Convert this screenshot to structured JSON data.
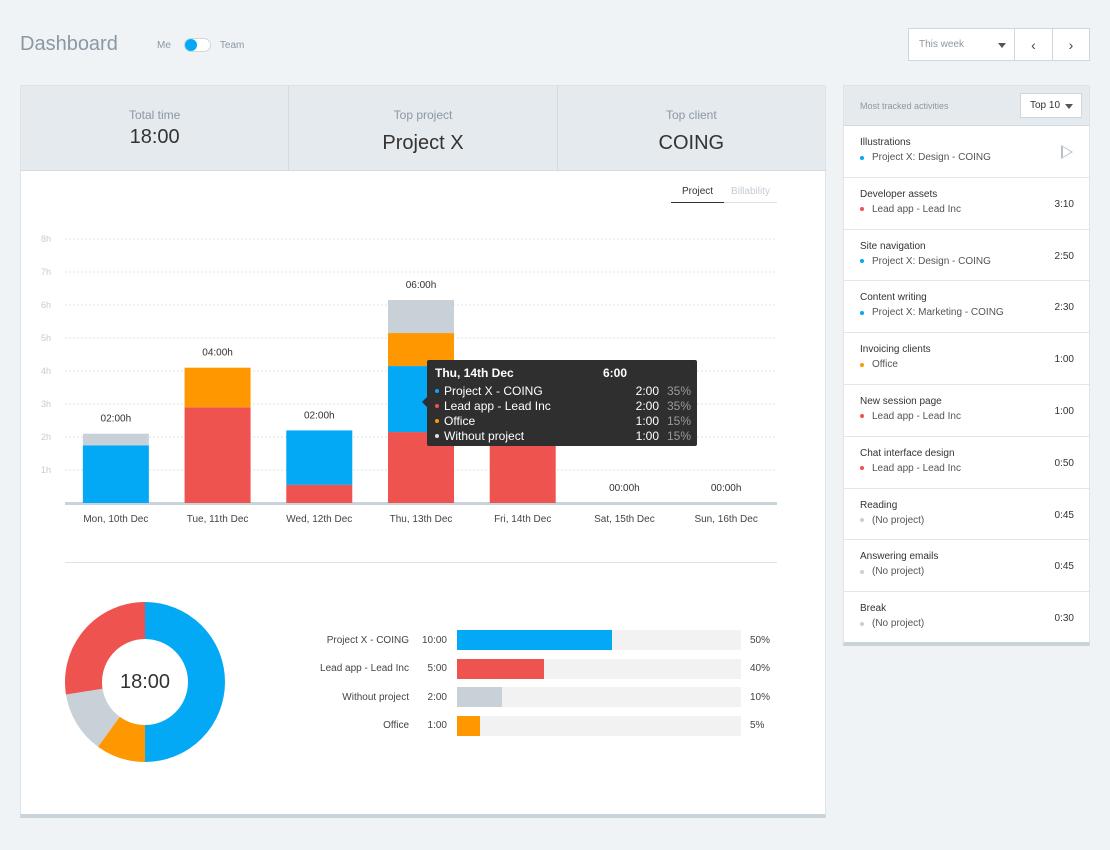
{
  "header": {
    "title": "Dashboard",
    "toggle_left": "Me",
    "toggle_right": "Team",
    "range_label": "This week",
    "prev_glyph": "‹",
    "next_glyph": "›"
  },
  "summary": [
    {
      "label": "Total time",
      "value": "18:00"
    },
    {
      "label": "Top project",
      "value": "Project X"
    },
    {
      "label": "Top client",
      "value": "COING"
    }
  ],
  "chart_tabs": [
    "Project",
    "Billability"
  ],
  "colors": {
    "project_x": "#03a9f4",
    "lead_app": "#ef5350",
    "office": "#ff9800",
    "no_project": "#c8d1d8"
  },
  "chart_data": {
    "type": "bar",
    "stacked": true,
    "categories": [
      "Mon, 10th Dec",
      "Tue, 11th Dec",
      "Wed, 12th Dec",
      "Thu, 13th Dec",
      "Fri, 14th Dec",
      "Sat, 15th Dec",
      "Sun, 16th Dec"
    ],
    "totals_labels": [
      "02:00h",
      "04:00h",
      "02:00h",
      "06:00h",
      "",
      "00:00h",
      "00:00h"
    ],
    "y_ticks": [
      "1h",
      "2h",
      "3h",
      "4h",
      "5h",
      "6h",
      "7h",
      "8h"
    ],
    "ylim": [
      0,
      8
    ],
    "grid": true,
    "series": [
      {
        "name": "Lead app - Lead Inc",
        "color": "#ef5350",
        "values": [
          0,
          2.9,
          0.55,
          2.15,
          2.05,
          0,
          0
        ]
      },
      {
        "name": "Project X - COING",
        "color": "#03a9f4",
        "values": [
          1.75,
          0,
          1.65,
          2.0,
          0,
          0,
          0
        ]
      },
      {
        "name": "Office",
        "color": "#ff9800",
        "values": [
          0,
          1.2,
          0,
          1.0,
          0,
          0,
          0
        ]
      },
      {
        "name": "Without project",
        "color": "#c8d1d8",
        "values": [
          0.35,
          0,
          0,
          1.0,
          0,
          0,
          0
        ]
      }
    ]
  },
  "tooltip": {
    "date": "Thu, 14th Dec",
    "total": "6:00",
    "rows": [
      {
        "name": "Project X - COING",
        "time": "2:00",
        "pct": "35%",
        "color": "#03a9f4"
      },
      {
        "name": "Lead app - Lead Inc",
        "time": "2:00",
        "pct": "35%",
        "color": "#ef5350"
      },
      {
        "name": "Office",
        "time": "1:00",
        "pct": "15%",
        "color": "#ff9800"
      },
      {
        "name": "Without project",
        "time": "1:00",
        "pct": "15%",
        "color": "#e0e0e0"
      }
    ]
  },
  "donut": {
    "center_label": "18:00",
    "segments": [
      {
        "name": "Project X - COING",
        "fraction": 0.5,
        "color": "#03a9f4"
      },
      {
        "name": "Office",
        "fraction": 0.1,
        "color": "#ff9800"
      },
      {
        "name": "Without project",
        "fraction": 0.125,
        "color": "#c8d1d8"
      },
      {
        "name": "Lead app - Lead Inc",
        "fraction": 0.275,
        "color": "#ef5350"
      }
    ]
  },
  "breakdown": [
    {
      "name": "Project X - COING",
      "time": "10:00",
      "pct": "50%",
      "fill": 0.545,
      "color": "#03a9f4"
    },
    {
      "name": "Lead app - Lead Inc",
      "time": "5:00",
      "pct": "40%",
      "fill": 0.305,
      "color": "#ef5350"
    },
    {
      "name": "Without project",
      "time": "2:00",
      "pct": "10%",
      "fill": 0.158,
      "color": "#c8d1d8"
    },
    {
      "name": "Office",
      "time": "1:00",
      "pct": "5%",
      "fill": 0.08,
      "color": "#ff9800"
    }
  ],
  "sidebar": {
    "title": "Most tracked activities",
    "top_select": "Top 10",
    "activities": [
      {
        "name": "Illustrations",
        "project": "Project X: Design - COING",
        "time": "",
        "color": "#03a9f4"
      },
      {
        "name": "Developer assets",
        "project": "Lead app - Lead Inc",
        "time": "3:10",
        "color": "#ef5350"
      },
      {
        "name": "Site navigation",
        "project": "Project X: Design - COING",
        "time": "2:50",
        "color": "#03a9f4"
      },
      {
        "name": "Content writing",
        "project": "Project X: Marketing - COING",
        "time": "2:30",
        "color": "#03a9f4"
      },
      {
        "name": "Invoicing clients",
        "project": "Office",
        "time": "1:00",
        "color": "#ff9800"
      },
      {
        "name": "New session page",
        "project": "Lead app - Lead Inc",
        "time": "1:00",
        "color": "#ef5350"
      },
      {
        "name": "Chat interface design",
        "project": "Lead app - Lead Inc",
        "time": "0:50",
        "color": "#ef5350"
      },
      {
        "name": "Reading",
        "project": "(No project)",
        "time": "0:45",
        "color": "#c8d1d8"
      },
      {
        "name": "Answering emails",
        "project": "(No project)",
        "time": "0:45",
        "color": "#c8d1d8"
      },
      {
        "name": "Break",
        "project": "(No project)",
        "time": "0:30",
        "color": "#c8d1d8"
      }
    ]
  }
}
